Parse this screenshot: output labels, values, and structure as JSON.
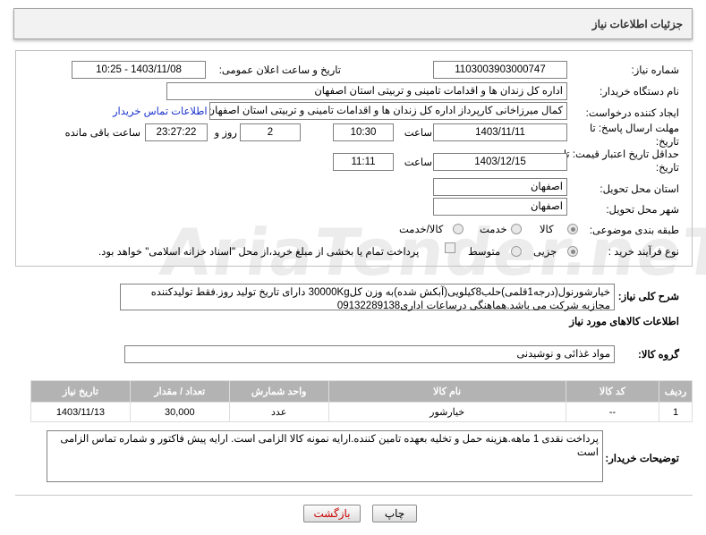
{
  "header": {
    "title": "جزئیات اطلاعات نیاز"
  },
  "form": {
    "need_number_label": "شماره نیاز:",
    "need_number": "1103003903000747",
    "announce_label": "تاریخ و ساعت اعلان عمومی:",
    "announce_value": "1403/11/08 - 10:25",
    "buyer_label": "نام دستگاه خریدار:",
    "buyer_value": "اداره کل زندان ها و اقدامات تامینی و تربیتی استان اصفهان",
    "creator_label": "ایجاد کننده درخواست:",
    "creator_value": "کمال میرزاخانی کارپرداز اداره کل زندان ها و اقدامات تامینی و تربیتی استان اصفهان",
    "contact_link": "اطلاعات تماس خریدار",
    "deadline_label": "مهلت ارسال پاسخ: تا تاریخ:",
    "deadline_date": "1403/11/11",
    "time_label": "ساعت",
    "deadline_time": "10:30",
    "days_value": "2",
    "days_label": "روز و",
    "remaining_time": "23:27:22",
    "remaining_label": "ساعت باقی مانده",
    "validity_label": "حداقل تاریخ اعتبار قیمت: تا تاریخ:",
    "validity_date": "1403/12/15",
    "validity_time_label": "ساعت",
    "validity_time": "11:11",
    "province_label": "استان محل تحویل:",
    "province_value": "اصفهان",
    "city_label": "شهر محل تحویل:",
    "city_value": "اصفهان",
    "category_label": "طبقه بندی موضوعی:",
    "category_options": [
      "کالا",
      "خدمت",
      "کالا/خدمت"
    ],
    "purchase_label": "نوع فرآیند خرید :",
    "purchase_options": [
      "جزیی",
      "متوسط"
    ],
    "treasury_note": "پرداخت تمام یا بخشی از مبلغ خرید،از محل \"اسناد خزانه اسلامی\" خواهد بود."
  },
  "summary": {
    "label": "شرح کلی نیاز:",
    "text": "خیارشورنول(درجه1قلمی)حلب8کیلویی(آبکش شده)به وزن کل30000Kg دارای تاریخ تولید روز.فقط تولیدکننده مجازبه شرکت می باشد.هماهنگی درساعات اداری09132289138"
  },
  "goods": {
    "section_title": "اطلاعات کالاهای مورد نیاز",
    "group_label": "گروه کالا:",
    "group_value": "مواد غذائی و نوشیدنی",
    "columns": [
      "ردیف",
      "کد کالا",
      "نام کالا",
      "واحد شمارش",
      "تعداد / مقدار",
      "تاریخ نیاز"
    ],
    "rows": [
      [
        "1",
        "--",
        "خیارشور",
        "عدد",
        "30,000",
        "1403/11/13"
      ]
    ]
  },
  "buyer_notes": {
    "label": "توضیحات خریدار:",
    "text": "پرداخت نقدی 1 ماهه.هزینه حمل و تخلیه بعهده تامین کننده.ارایه نمونه کالا الزامی است. ارایه پیش فاکتور و شماره تماس الزامی است"
  },
  "buttons": {
    "print": "چاپ",
    "back": "بازگشت"
  },
  "watermark": "AriaTender.neT"
}
